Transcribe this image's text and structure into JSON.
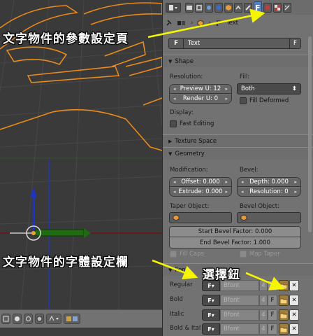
{
  "annotations": {
    "props_page": "文字物件的參數設定頁",
    "font_panel": "文字物件的字體設定欄",
    "select_button": "選擇鈕",
    "arrow_color": "#f5f500"
  },
  "breadcrumb": {
    "object": "Text"
  },
  "datablock": {
    "type": "F",
    "name": "Text",
    "fake_user": "F"
  },
  "shape": {
    "title": "Shape",
    "resolution_label": "Resolution:",
    "preview_u": "Preview U: 12",
    "render_u": "Render U: 0",
    "fill_label": "Fill:",
    "fill_value": "Both",
    "fill_deformed": "Fill Deformed",
    "display_label": "Display:",
    "fast_editing": "Fast Editing"
  },
  "texture_space": {
    "title": "Texture Space"
  },
  "geometry": {
    "title": "Geometry",
    "modification_label": "Modification:",
    "offset": "Offset: 0.000",
    "extrude": "Extrude: 0.000",
    "bevel_label": "Bevel:",
    "depth": "Depth: 0.000",
    "resolution": "Resolution: 0",
    "taper_label": "Taper Object:",
    "bevel_object_label": "Bevel Object:",
    "start_bevel": "Start Bevel Factor: 0.000",
    "end_bevel": "End Bevel Factor: 1.000",
    "fill_caps": "Fill Caps",
    "map_taper": "Map Taper"
  },
  "font": {
    "title": "Font",
    "rows": [
      {
        "label": "Regular",
        "name": "Bfont",
        "count": "4",
        "f": "F"
      },
      {
        "label": "Bold",
        "name": "Bfont",
        "count": "4",
        "f": "F"
      },
      {
        "label": "Italic",
        "name": "Bfont",
        "count": "4",
        "f": "F"
      },
      {
        "label": "Bold & Ital",
        "name": "Bfont",
        "count": "4",
        "f": "F"
      }
    ]
  },
  "colors": {
    "active_tab": "#5680c2",
    "wire_orange": "#e88a1c",
    "x_axis": "#7a0b0b",
    "y_axis": "#2e7a1c",
    "z_axis": "#1e34c8"
  }
}
